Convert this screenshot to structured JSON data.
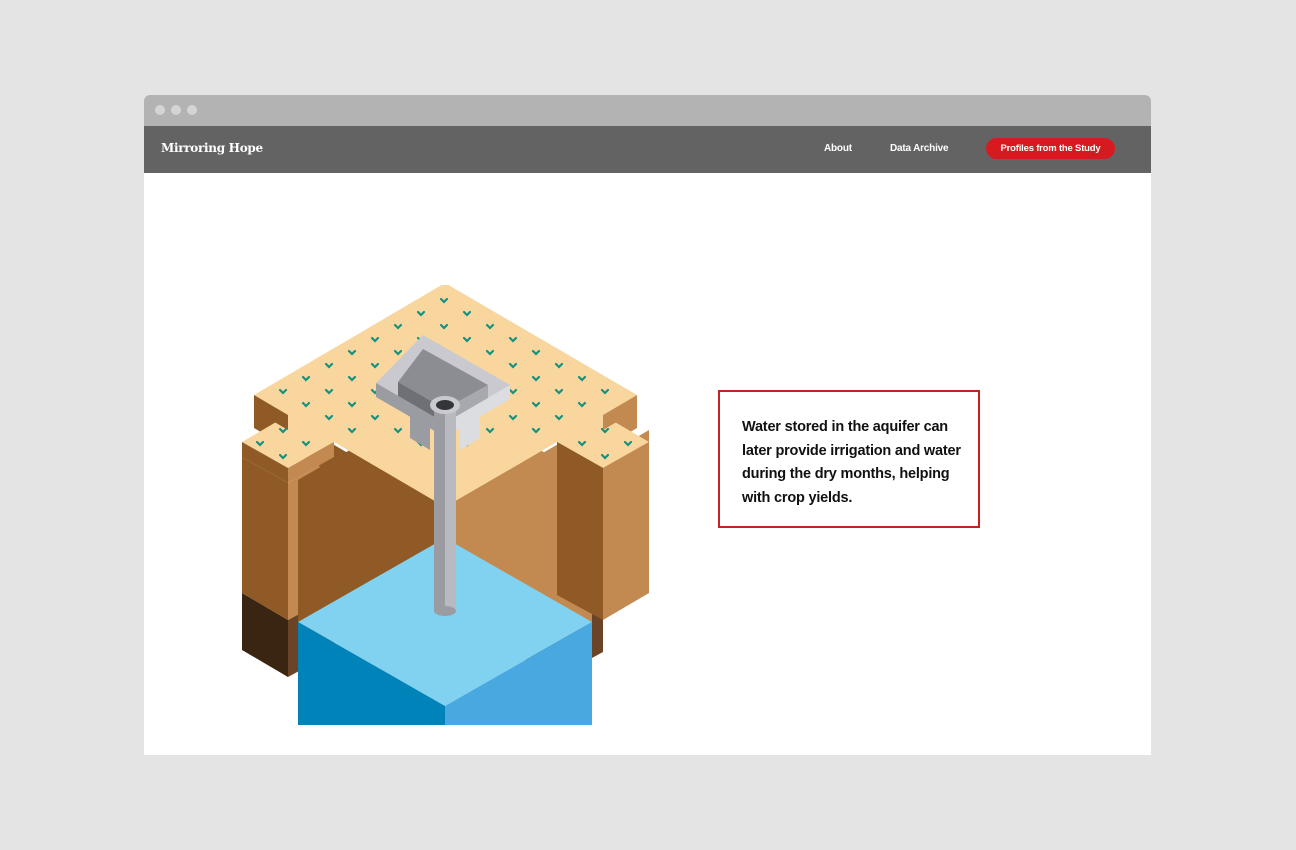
{
  "window": {
    "controls": [
      "close",
      "minimize",
      "maximize"
    ]
  },
  "nav": {
    "brand": "Mirroring Hope",
    "links": [
      {
        "label": "About"
      },
      {
        "label": "Data Archive"
      }
    ],
    "cta_label": "Profiles from the Study"
  },
  "colors": {
    "nav_bg": "#636363",
    "accent": "#d71920",
    "titlebar": "#b3b3b3",
    "soil_top": "#f9d69e",
    "soil_side_light": "#c28a50",
    "soil_side_dark": "#8f5a25",
    "water_top": "#80d2f0",
    "water_right": "#4aa8e0",
    "water_left": "#0083b8",
    "sprout": "#12937f"
  },
  "illustration": {
    "description_icon": "aquifer-cutaway-illustration"
  },
  "callout": {
    "text": "Water stored in the aquifer can later provide irrigation and water during the dry months, helping with crop yields."
  }
}
